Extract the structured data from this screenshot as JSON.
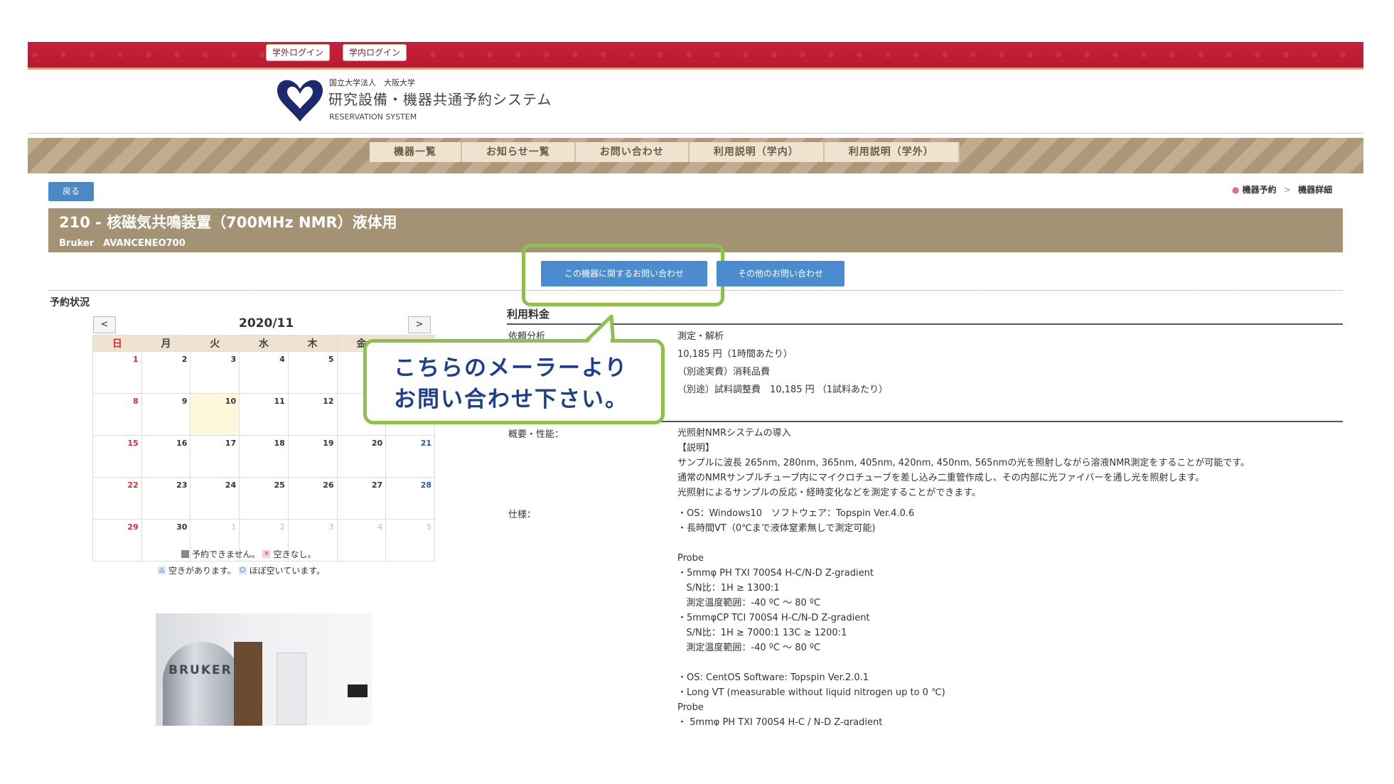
{
  "header": {
    "login_external": "学外ログイン",
    "login_internal": "学内ログイン",
    "logo_small": "国立大学法人　大阪大学",
    "logo_main": "研究設備・機器共通予約システム",
    "logo_sub": "RESERVATION SYSTEM"
  },
  "nav": [
    "機器一覧",
    "お知らせ一覧",
    "お問い合わせ",
    "利用説明（学内）",
    "利用説明（学外）"
  ],
  "back_label": "戻る",
  "breadcrumb": [
    "機器予約",
    "機器詳細"
  ],
  "equipment": {
    "title": "210 - 核磁気共鳴装置（700MHz NMR）液体用",
    "subtitle": "Bruker　AVANCENEO700"
  },
  "buttons": {
    "inquiry_equipment": "この機器に関するお問い合わせ",
    "inquiry_other": "その他のお問い合わせ"
  },
  "reservation": {
    "label": "予約状況",
    "month": "2020/11",
    "prev": "<",
    "next": ">",
    "weekdays": [
      "日",
      "月",
      "火",
      "水",
      "木",
      "金"
    ],
    "legend_line1": [
      "予約できません。",
      "空きなし。"
    ],
    "legend_line2": [
      "空きがあります。",
      "ほぼ空いています。"
    ],
    "legend_mark_x": "×",
    "legend_mark_triangle": "△",
    "legend_mark_circle": "○"
  },
  "calendar_rows": [
    [
      "1",
      "2",
      "3",
      "4",
      "5",
      "",
      ""
    ],
    [
      "8",
      "9",
      "10",
      "11",
      "12",
      "",
      ""
    ],
    [
      "15",
      "16",
      "17",
      "18",
      "19",
      "20",
      "21"
    ],
    [
      "22",
      "23",
      "24",
      "25",
      "26",
      "27",
      "28"
    ],
    [
      "29",
      "30",
      "1",
      "2",
      "3",
      "4",
      "5"
    ]
  ],
  "photo": {
    "brand_text": "BRUKER"
  },
  "pricing": {
    "heading": "利用料金",
    "row_label": "依頼分析",
    "lines": [
      "測定・解析",
      "10,185 円（1時間あたり）",
      "（別途実費）消耗品費",
      "（別途）試料調整費　10,185 円 （1試料あたり）"
    ]
  },
  "overview": {
    "label": "概要・性能：",
    "lines": [
      "光照射NMRシステムの導入",
      "【説明】",
      "サンプルに波長 265nm, 280nm, 365nm, 405nm, 420nm, 450nm, 565nmの光を照射しながら溶液NMR測定をすることが可能です。",
      "通常のNMRサンプルチューブ内にマイクロチューブを差し込み二重管作成し、その内部に光ファイバーを通し光を照射します。",
      "光照射によるサンプルの反応・経時変化などを測定することができます。"
    ]
  },
  "specs": {
    "label": "仕様：",
    "lines": [
      "・OS：Windows10　ソフトウェア：Topspin Ver.4.0.6",
      "・長時間VT（0℃まで液体窒素無しで測定可能)",
      "",
      "Probe",
      "・5mmφ PH TXI 700S4 H-C/N-D Z-gradient",
      "   S/N比：1H ≥ 1300:1",
      "   測定温度範囲：-40 ºC ～ 80 ºC",
      "・5mmφCP TCI 700S4 H-C/N-D Z-gradient",
      "   S/N比：1H ≥ 7000:1 13C ≥ 1200:1",
      "   測定温度範囲：-40 ºC ～ 80 ºC",
      "",
      "・OS: CentOS Software: Topspin Ver.2.0.1",
      "・Long VT (measurable without liquid nitrogen up to 0 ℃)",
      "Probe",
      "・ 5mmφ PH TXI 700S4 H-C / N-D Z-gradient"
    ]
  },
  "callout": {
    "line1": "こちらのメーラーより",
    "line2": "お問い合わせ下さい。"
  }
}
